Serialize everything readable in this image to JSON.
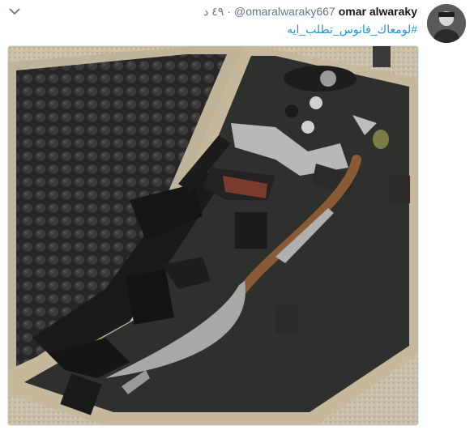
{
  "tweet": {
    "display_name": "omar alwaraky",
    "handle": "@omaralwaraky667",
    "separator": "·",
    "time": "٤٩ د",
    "hashtag": "#لومعاك_فانوس_تطلب_ايه"
  },
  "icons": {
    "menu": "chevron-down-icon"
  },
  "colors": {
    "link": "#1b95e0",
    "name": "#14171a",
    "meta": "#657786"
  }
}
